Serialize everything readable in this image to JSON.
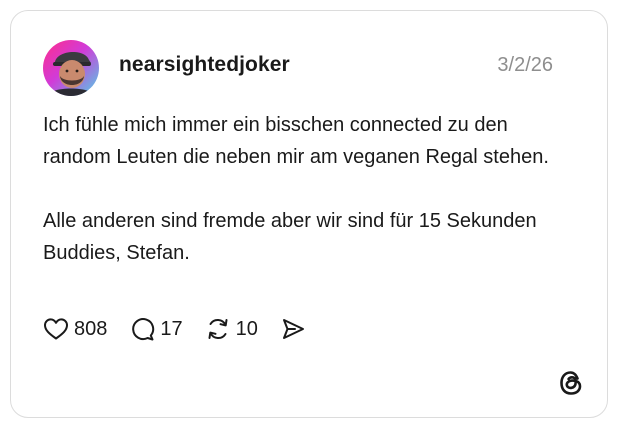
{
  "post": {
    "username": "nearsightedjoker",
    "date": "3/2/26",
    "paragraphs": [
      "Ich fühle mich immer ein bisschen connected zu den random Leuten die neben mir am veganen Regal stehen.",
      "Alle anderen sind fremde aber wir sind für 15 Sekunden Buddies, Stefan."
    ],
    "likes": "808",
    "replies": "17",
    "reposts": "10"
  },
  "icons": {
    "like": "heart-icon",
    "reply": "speech-bubble-icon",
    "repost": "repost-arrows-icon",
    "share": "send-paper-plane-icon",
    "brand": "threads-logo-icon"
  },
  "colors": {
    "avatar_gradient": [
      "#ff2d8a",
      "#d13bd8",
      "#4fd2e6"
    ],
    "date_text": "#8e8e8e",
    "border": "#dcdcdc"
  }
}
